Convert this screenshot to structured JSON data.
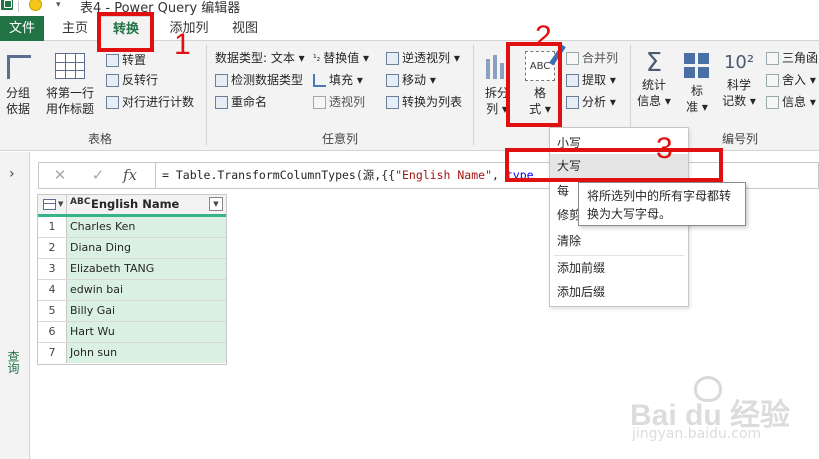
{
  "window": {
    "title": "表4 - Power Query 编辑器"
  },
  "tabs": [
    {
      "label": "文件"
    },
    {
      "label": "主页"
    },
    {
      "label": "转换"
    },
    {
      "label": "添加列"
    },
    {
      "label": "视图"
    }
  ],
  "ribbon": {
    "table_group": {
      "label": "表格",
      "group_by_1": "分组",
      "group_by_2": "依据",
      "use_first_row_1": "将第一行",
      "use_first_row_2": "用作标题",
      "transpose": "转置",
      "reverse_rows": "反转行",
      "count_rows": "对行进行计数"
    },
    "any_column_group": {
      "label": "任意列",
      "data_type": "数据类型: 文本",
      "detect_type": "检测数据类型",
      "rename": "重命名",
      "replace_values": "替换值",
      "fill": "填充",
      "pivot_column": "透视列",
      "unpivot": "逆透视列",
      "move": "移动",
      "convert_to_list": "转换为列表"
    },
    "text_column_group": {
      "split_1": "拆分",
      "split_2": "列",
      "format_1": "格",
      "format_2": "式",
      "merge": "合并列",
      "extract": "提取",
      "parse": "分析"
    },
    "number_column_group": {
      "label": "编号列",
      "statistics_1": "统计",
      "statistics_2": "信息",
      "standard_1": "标",
      "standard_2": "准",
      "scientific_1": "科学",
      "scientific_2": "记数",
      "trig": "三角函",
      "rounding": "舍入",
      "information": "信息"
    }
  },
  "annotations": {
    "n1": "1",
    "n2": "2",
    "n3": "3",
    "color": "#e01010"
  },
  "query_pane": {
    "label": "查询"
  },
  "formula_bar": {
    "cancel": "✕",
    "confirm": "✓",
    "fx": "fx",
    "prefix": "= Table.TransformColumnTypes(源,{{",
    "string": "\"English Name\"",
    "sep": ", ",
    "type_kw": "type"
  },
  "table": {
    "column_type": "ABC",
    "column_name": "English Name",
    "rows": [
      {
        "n": "1",
        "v": "Charles Ken"
      },
      {
        "n": "2",
        "v": "Diana Ding"
      },
      {
        "n": "3",
        "v": "Elizabeth TANG"
      },
      {
        "n": "4",
        "v": "edwin bai"
      },
      {
        "n": "5",
        "v": "Billy Gai"
      },
      {
        "n": "6",
        "v": "Hart Wu"
      },
      {
        "n": "7",
        "v": "John sun"
      }
    ]
  },
  "format_menu": {
    "lowercase": "小写",
    "uppercase": "大写",
    "capitalize_partial": "每",
    "trim_partial": "修剪",
    "clean": "清除",
    "add_prefix": "添加前缀",
    "add_suffix": "添加后缀"
  },
  "tooltip": {
    "line1": "将所选列中的所有字母都转",
    "line2": "换为大写字母。"
  },
  "watermark": {
    "brand": "Bai du 经验",
    "site": "jingyan.baidu.com"
  },
  "colors": {
    "excel_green": "#217346",
    "grid_header_underline": "#36b38a",
    "cell_fill": "#d9f0e3",
    "annotation_red": "#e01010"
  }
}
